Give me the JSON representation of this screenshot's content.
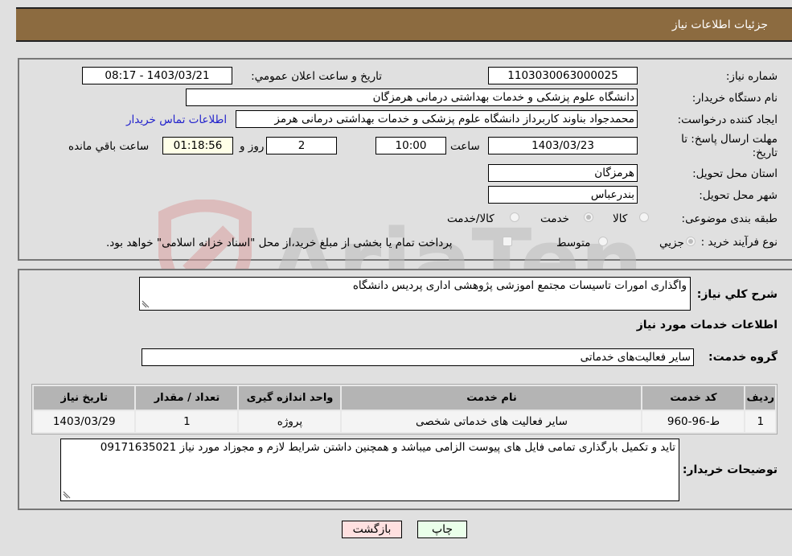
{
  "header": {
    "title": "جزئیات اطلاعات نیاز"
  },
  "form": {
    "need_number_label": "شماره نیاز:",
    "need_number": "1103030063000025",
    "announce_label": "تاريخ و ساعت اعلان عمومي:",
    "announce_value": "1403/03/21 - 08:17",
    "buyer_org_label": "نام دستگاه خریدار:",
    "buyer_org": "دانشگاه علوم پزشکی و خدمات بهداشتی درمانی هرمزگان",
    "creator_label": "ایجاد کننده درخواست:",
    "creator": "محمدجواد بناوند کاربرداز دانشگاه علوم پزشکی و خدمات بهداشتی درمانی هرمز",
    "contact_link": "اطلاعات تماس خریدار",
    "deadline_label": "مهلت ارسال پاسخ: تا تاریخ:",
    "deadline_date": "1403/03/23",
    "time_label": "ساعت",
    "deadline_time": "10:00",
    "days": "2",
    "days_label": "روز و",
    "remaining": "01:18:56",
    "remaining_label": "ساعت باقي مانده",
    "province_label": "استان محل تحویل:",
    "province": "هرمزگان",
    "city_label": "شهر محل تحویل:",
    "city": "بندرعباس",
    "category_label": "طبقه بندی موضوعی:",
    "category_options": [
      {
        "label": "کالا",
        "selected": false
      },
      {
        "label": "خدمت",
        "selected": true
      },
      {
        "label": "کالا/خدمت",
        "selected": false
      }
    ],
    "purchase_type_label": "نوع فرآیند خرید :",
    "purchase_options": [
      {
        "label": "جزیي",
        "selected": true
      },
      {
        "label": "متوسط",
        "selected": false
      }
    ],
    "treasury_note": "پرداخت تمام یا بخشی از مبلغ خرید،از محل \"اسناد خزانه اسلامی\" خواهد بود.",
    "treasury_checked": false
  },
  "description": {
    "label": "شرح کلي نياز:",
    "value": "واگذاری امورات  تاسیسات مجتمع اموزشی پژوهشی  اداری پردیس دانشگاه"
  },
  "services": {
    "section_title": "اطلاعات خدمات مورد نیاز",
    "group_label": "گروه خدمت:",
    "group_value": "سایر فعالیت‌های خدماتی",
    "columns": [
      "ردیف",
      "کد خدمت",
      "نام خدمت",
      "واحد اندازه گیری",
      "تعداد / مقدار",
      "تاریخ نیاز"
    ],
    "rows": [
      [
        "1",
        "ط-96-960",
        "سایر فعالیت های خدماتی شخصی",
        "پروژه",
        "1",
        "1403/03/29"
      ]
    ]
  },
  "buyer_notes": {
    "label": "توضیحات خریدار:",
    "value": "تاید و  تکمیل بارگذاری  تمامی فایل های  پیوست الزامی میباشد و همچنین  داشتن شرایط لازم و مجوزاد مورد نیاز 09171635021"
  },
  "buttons": {
    "print": "چاپ",
    "back": "بازگشت"
  },
  "colors": {
    "header_bg": "#8c6b40",
    "print_bg": "#eaffea",
    "back_bg": "#ffe0e0",
    "link": "#2222cc"
  }
}
